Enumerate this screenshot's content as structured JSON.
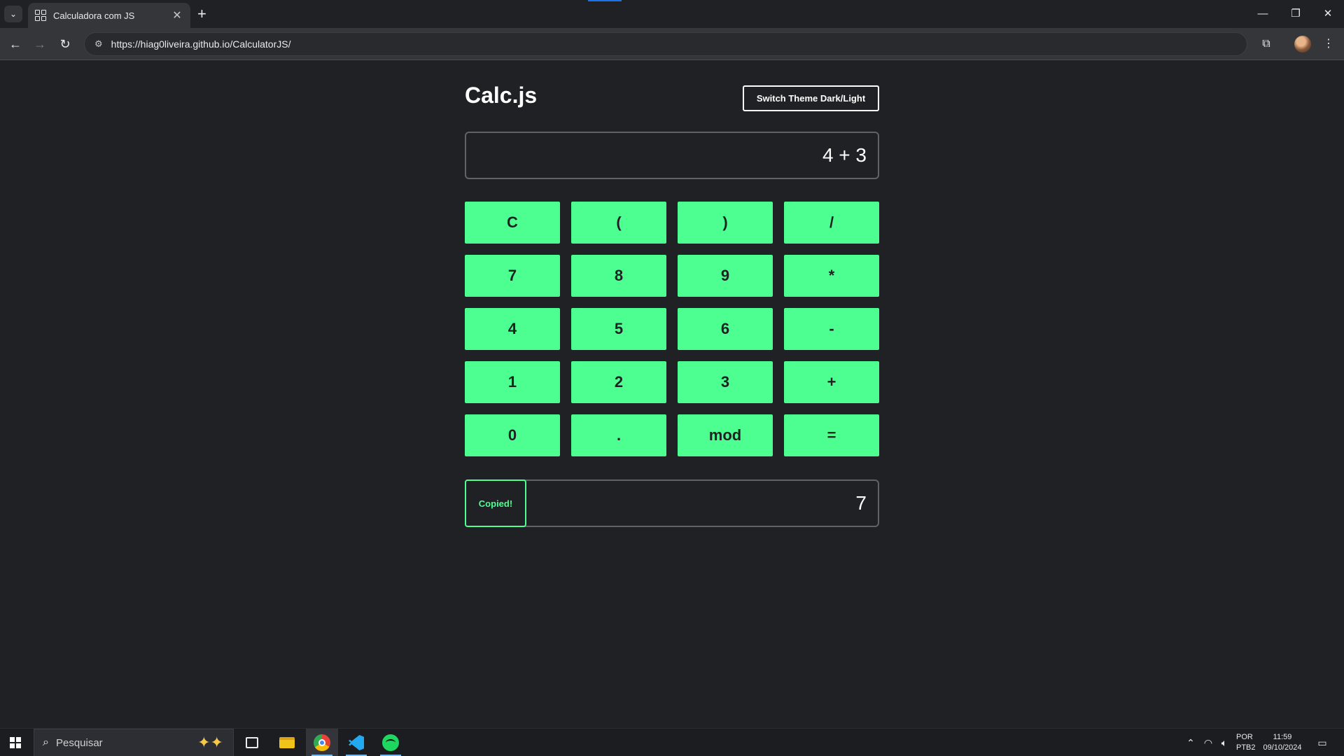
{
  "browser": {
    "tab_title": "Calculadora com JS",
    "tab_close": "✕",
    "new_tab": "+",
    "url": "https://hiag0liveira.github.io/CalculatorJS/",
    "window_controls": {
      "minimize": "—",
      "restore": "❐",
      "close": "✕"
    }
  },
  "app": {
    "title": "Calc.js",
    "theme_button": "Switch Theme Dark/Light",
    "expression": "4 + 3",
    "keys": [
      "C",
      "(",
      ")",
      "/",
      "7",
      "8",
      "9",
      "*",
      "4",
      "5",
      "6",
      "-",
      "1",
      "2",
      "3",
      "+",
      "0",
      ".",
      "mod",
      "="
    ],
    "copy_button": "Copied!",
    "result": "7"
  },
  "taskbar": {
    "search_placeholder": "Pesquisar",
    "language_line1": "POR",
    "language_line2": "PTB2",
    "time": "11:59",
    "date": "09/10/2024"
  },
  "colors": {
    "accent_green": "#4dff91",
    "page_background": "#202124"
  },
  "icons": {
    "tab_search": "chevron-down-icon",
    "back": "arrow-left-icon",
    "forward": "arrow-right-icon",
    "reload": "reload-icon",
    "site_info": "tune-icon",
    "extensions": "puzzle-icon",
    "menu": "kebab-menu-icon"
  }
}
